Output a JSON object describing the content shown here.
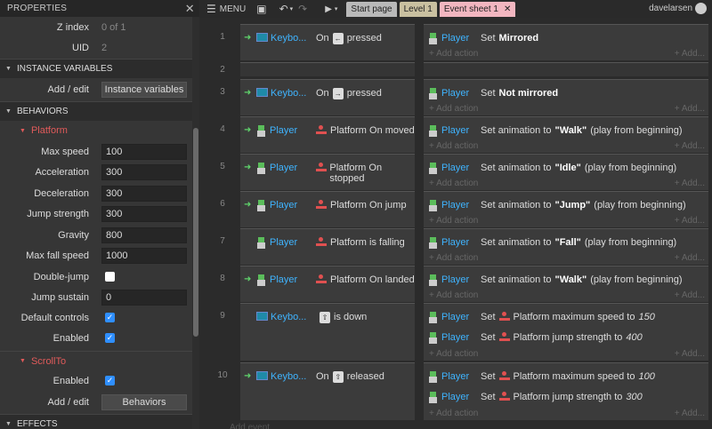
{
  "properties": {
    "title": "PROPERTIES",
    "zindex": {
      "label": "Z index",
      "value": "0 of 1"
    },
    "uid": {
      "label": "UID",
      "value": "2"
    },
    "instance_variables": {
      "header": "INSTANCE VARIABLES",
      "label": "Add / edit",
      "button": "Instance variables"
    },
    "behaviors": {
      "header": "BEHAVIORS",
      "platform": {
        "name": "Platform",
        "fields": [
          {
            "label": "Max speed",
            "value": "100"
          },
          {
            "label": "Acceleration",
            "value": "300"
          },
          {
            "label": "Deceleration",
            "value": "300"
          },
          {
            "label": "Jump strength",
            "value": "300"
          },
          {
            "label": "Gravity",
            "value": "800"
          },
          {
            "label": "Max fall speed",
            "value": "1000"
          }
        ],
        "double_jump": {
          "label": "Double-jump",
          "checked": false
        },
        "jump_sustain": {
          "label": "Jump sustain",
          "value": "0"
        },
        "default_controls": {
          "label": "Default controls",
          "checked": true
        },
        "enabled": {
          "label": "Enabled",
          "checked": true
        }
      },
      "scrollto": {
        "name": "ScrollTo",
        "enabled": {
          "label": "Enabled",
          "checked": true
        }
      },
      "add_edit": {
        "label": "Add / edit",
        "button": "Behaviors"
      }
    },
    "effects": {
      "header": "EFFECTS"
    }
  },
  "topbar": {
    "menu": "MENU",
    "tabs": [
      {
        "label": "Start page",
        "color": "#b9b9b9"
      },
      {
        "label": "Level 1",
        "color": "#c9c0a0"
      },
      {
        "label": "Event sheet 1",
        "color": "#f2b6c0"
      }
    ],
    "user": "davelarsen"
  },
  "events": [
    {
      "num": "1",
      "trigger": true,
      "obj": "Keybo...",
      "objicon": "keyboard",
      "cond_prefix": "On",
      "key": "←",
      "cond_suffix": "pressed",
      "actions": [
        {
          "obj": "Player",
          "set": "Set",
          "bold": "Mirrored",
          "rest": ""
        }
      ]
    },
    {
      "num": "2",
      "empty": true
    },
    {
      "num": "3",
      "trigger": true,
      "obj": "Keybo...",
      "objicon": "keyboard",
      "cond_prefix": "On",
      "key": "→",
      "cond_suffix": "pressed",
      "actions": [
        {
          "obj": "Player",
          "set": "Set",
          "bold": "Not mirrored",
          "rest": ""
        }
      ]
    },
    {
      "num": "4",
      "trigger": true,
      "obj": "Player",
      "objicon": "player",
      "cond_text": "Platform On moved",
      "actions": [
        {
          "obj": "Player",
          "set": "Set animation to",
          "bold": "\"Walk\"",
          "rest": "(play from beginning)"
        }
      ]
    },
    {
      "num": "5",
      "trigger": true,
      "obj": "Player",
      "objicon": "player",
      "cond_text": "Platform On stopped",
      "actions": [
        {
          "obj": "Player",
          "set": "Set animation to",
          "bold": "\"Idle\"",
          "rest": "(play from beginning)"
        }
      ]
    },
    {
      "num": "6",
      "trigger": true,
      "obj": "Player",
      "objicon": "player",
      "cond_text": "Platform On jump",
      "actions": [
        {
          "obj": "Player",
          "set": "Set animation to",
          "bold": "\"Jump\"",
          "rest": "(play from beginning)"
        }
      ]
    },
    {
      "num": "7",
      "trigger": false,
      "obj": "Player",
      "objicon": "player",
      "cond_text": "Platform is falling",
      "actions": [
        {
          "obj": "Player",
          "set": "Set animation to",
          "bold": "\"Fall\"",
          "rest": "(play from beginning)"
        }
      ]
    },
    {
      "num": "8",
      "trigger": true,
      "obj": "Player",
      "objicon": "player",
      "cond_text": "Platform On landed",
      "actions": [
        {
          "obj": "Player",
          "set": "Set animation to",
          "bold": "\"Walk\"",
          "rest": "(play from beginning)"
        }
      ]
    },
    {
      "num": "9",
      "trigger": false,
      "obj": "Keybo...",
      "objicon": "keyboard",
      "cond_prefix": "",
      "key": "⇧",
      "cond_suffix": "is down",
      "actions": [
        {
          "obj": "Player",
          "set": "Set",
          "plat": true,
          "text": "Platform maximum speed to",
          "ital": "150"
        },
        {
          "obj": "Player",
          "set": "Set",
          "plat": true,
          "text": "Platform jump strength to",
          "ital": "400"
        }
      ]
    },
    {
      "num": "10",
      "trigger": true,
      "obj": "Keybo...",
      "objicon": "keyboard",
      "cond_prefix": "On",
      "key": "⇧",
      "cond_suffix": "released",
      "actions": [
        {
          "obj": "Player",
          "set": "Set",
          "plat": true,
          "text": "Platform maximum speed to",
          "ital": "100"
        },
        {
          "obj": "Player",
          "set": "Set",
          "plat": true,
          "text": "Platform jump strength to",
          "ital": "300"
        }
      ]
    }
  ],
  "labels": {
    "add_action": "+ Add action",
    "add": "+ Add...",
    "add_event": "Add event"
  }
}
